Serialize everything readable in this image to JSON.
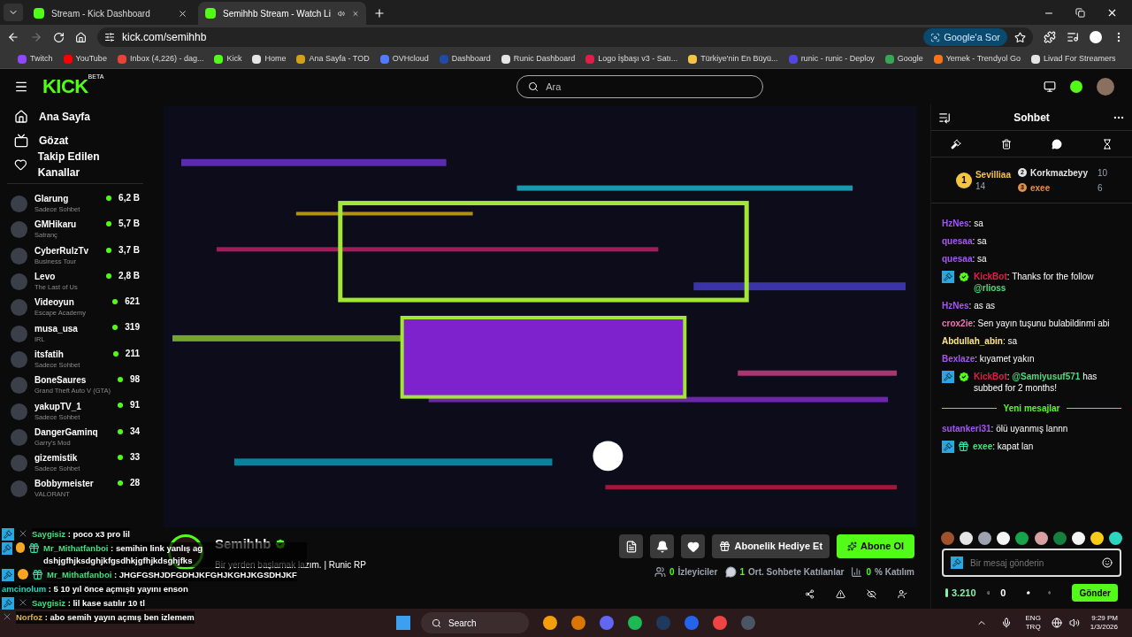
{
  "browser": {
    "tabs": [
      {
        "title": "Stream - Kick Dashboard",
        "selected": false,
        "audio": false
      },
      {
        "title": "Semihhb Stream - Watch Li",
        "selected": true,
        "audio": true
      }
    ],
    "url": "kick.com/semihhb",
    "ask_google": "Google'a Sor",
    "bookmarks": [
      "Twitch",
      "YouTube",
      "Inbox (4,226) - dag...",
      "Kick",
      "Home",
      "Ana Sayfa - TOD",
      "OVHcloud",
      "Dashboard",
      "Runic Dashboard",
      "Logo İşbaşı v3 - Satı...",
      "Türkiye'nin En Büyü...",
      "runic - runic - Deploy",
      "Google",
      "Yemek - Trendyol Go",
      "Livad For Streamers"
    ]
  },
  "header": {
    "logo": "KICK",
    "logo_tag": "BETA",
    "search_placeholder": "Ara"
  },
  "sidebar": {
    "nav": [
      {
        "label": "Ana Sayfa",
        "kind": "home"
      },
      {
        "label": "Gözat",
        "kind": "browse"
      },
      {
        "label": "Takip Edilen Kanallar",
        "kind": "following"
      }
    ],
    "channels": [
      {
        "name": "Glarung",
        "category": "Sadece Sohbet",
        "viewers": "6,2 B"
      },
      {
        "name": "GMHikaru",
        "category": "Satranç",
        "viewers": "5,7 B"
      },
      {
        "name": "CyberRulzTv",
        "category": "Business Tour",
        "viewers": "3,7 B"
      },
      {
        "name": "Levo",
        "category": "The Last of Us",
        "viewers": "2,8 B"
      },
      {
        "name": "Videoyun",
        "category": "Escape Academy",
        "viewers": "621"
      },
      {
        "name": "musa_usa",
        "category": "IRL",
        "viewers": "319"
      },
      {
        "name": "itsfatih",
        "category": "Sadece Sohbet",
        "viewers": "211"
      },
      {
        "name": "BoneSaures",
        "category": "Grand Theft Auto V (GTA)",
        "viewers": "98"
      },
      {
        "name": "yakupTV_1",
        "category": "Sadece Sohbet",
        "viewers": "91"
      },
      {
        "name": "DangerGaminq",
        "category": "Garry's Mod",
        "viewers": "34"
      },
      {
        "name": "gizemistik",
        "category": "Sadece Sohbet",
        "viewers": "33"
      },
      {
        "name": "Bobbymeister",
        "category": "VALORANT",
        "viewers": "28"
      }
    ]
  },
  "stream": {
    "streamer": "Semihhb",
    "verified": true,
    "title": "Bir yerden başlamak lazım. | Runic RP",
    "buttons": [
      {
        "kind": "info"
      },
      {
        "kind": "bell"
      },
      {
        "kind": "heart"
      },
      {
        "kind": "gift",
        "label": "Abonelik Hediye Et"
      },
      {
        "kind": "primary",
        "label": "Abone Ol"
      }
    ],
    "stats": [
      {
        "value": "0",
        "label": "İzleyiciler"
      },
      {
        "value": "1",
        "label": "Ort. Sohbete Katılanlar"
      },
      {
        "value": "0",
        "label": "% Katılım"
      }
    ]
  },
  "overlay_chat": [
    {
      "user": "Saygisiz",
      "color": "#4ade80",
      "badges": [
        {
          "kind": "mod"
        },
        {
          "kind": "bot"
        }
      ],
      "sep": ":",
      "text": "poco x3 pro lil"
    },
    {
      "user": "Mr_Mithatfanboi",
      "color": "#4ade80",
      "badges": [
        {
          "kind": "mod"
        },
        {
          "kind": "one"
        },
        {
          "kind": "sub"
        }
      ],
      "sep": ":",
      "text": "semihin link yanlış ag dshjgfhjksdghjkfgsdhkjgfhjkdsghjfks"
    },
    {
      "user": "Mr_Mithatfanboi",
      "color": "#4ade80",
      "badges": [
        {
          "kind": "mod"
        },
        {
          "kind": "one"
        },
        {
          "kind": "sub"
        }
      ],
      "sep": ":",
      "text": "JHGFGSHJDFGDHJKFGHJKGHJKGSDHJKF"
    },
    {
      "user": "amcinolum",
      "color": "#2dd4bf",
      "sep": ":",
      "text": "5 10 yıl önce açmıştı yayını enson"
    },
    {
      "user": "Saygisiz",
      "color": "#4ade80",
      "badges": [
        {
          "kind": "mod"
        },
        {
          "kind": "bot"
        }
      ],
      "sep": ":",
      "text": "lil kase satılır 10 tl"
    },
    {
      "user": "Norfoz",
      "color": "#d6b35a",
      "badges": [
        {
          "kind": "bot"
        }
      ],
      "sep": ":",
      "text": "abo semih yayın açmış ben izlemem"
    }
  ],
  "chat": {
    "title": "Sohbet",
    "leaders": [
      {
        "rank": "1",
        "name": "Sevilliaa",
        "count": "14",
        "color": "#f5c542"
      },
      {
        "rank": "2",
        "name": "Korkmazbeyy",
        "count": "10",
        "color": "#e5e5e5"
      },
      {
        "rank": "3",
        "name": "exee",
        "count": "6",
        "color": "#e0904a"
      }
    ],
    "messages": [
      {
        "user": "HzNes",
        "color": "#a855f7",
        "sep": ":",
        "parts": [
          {
            "kind": "text",
            "text": "sa"
          }
        ]
      },
      {
        "user": "quesaa",
        "color": "#a855f7",
        "sep": ":",
        "parts": [
          {
            "kind": "text",
            "text": "sa"
          }
        ]
      },
      {
        "user": "quesaa",
        "color": "#a855f7",
        "sep": ":",
        "parts": [
          {
            "kind": "text",
            "text": "sa"
          }
        ]
      },
      {
        "user": "KickBot",
        "color": "#e11d48",
        "badges": [
          {
            "kind": "mod"
          },
          {
            "kind": "verified"
          }
        ],
        "sep": ":",
        "parts": [
          {
            "kind": "text",
            "text": "Thanks for the follow "
          },
          {
            "kind": "mention",
            "text": "@rlioss"
          }
        ]
      },
      {
        "user": "HzNes",
        "color": "#a855f7",
        "sep": ":",
        "parts": [
          {
            "kind": "text",
            "text": "as as"
          }
        ]
      },
      {
        "user": "crox2ie",
        "color": "#f472b6",
        "sep": ":",
        "parts": [
          {
            "kind": "text",
            "text": "Sen yayın tuşunu bulabildinmi abi"
          }
        ]
      },
      {
        "user": "Abdullah_abin",
        "color": "#fde68a",
        "sep": ":",
        "parts": [
          {
            "kind": "text",
            "text": "sa"
          }
        ]
      },
      {
        "user": "Bexlaze",
        "color": "#a855f7",
        "sep": ":",
        "parts": [
          {
            "kind": "text",
            "text": "kıyamet yakın"
          }
        ]
      },
      {
        "user": "KickBot",
        "color": "#e11d48",
        "badges": [
          {
            "kind": "mod"
          },
          {
            "kind": "verified"
          }
        ],
        "sep": ":",
        "parts": [
          {
            "kind": "mention",
            "text": "@Samiyusuf571"
          },
          {
            "kind": "text",
            "text": " has subbed for 2 months!"
          }
        ]
      },
      {
        "kind": "divider",
        "label": "Yeni mesajlar"
      },
      {
        "user": "sutankeri31",
        "color": "#a855f7",
        "sep": ":",
        "parts": [
          {
            "kind": "text",
            "text": "ölü uyanmış lannn"
          }
        ]
      },
      {
        "user": "exee",
        "color": "#4ade80",
        "badges": [
          {
            "kind": "mod"
          },
          {
            "kind": "sub"
          }
        ],
        "sep": ":",
        "parts": [
          {
            "kind": "text",
            "text": "kapat lan"
          }
        ]
      }
    ],
    "input_placeholder": "Bir mesaj gönderin",
    "points": "3.210",
    "store_count": "0",
    "send": "Gönder"
  },
  "taskbar": {
    "search_placeholder": "Search",
    "lang": "ENG",
    "layout": "TRQ",
    "time": "9:29 PM",
    "date": "1/3/2026"
  }
}
